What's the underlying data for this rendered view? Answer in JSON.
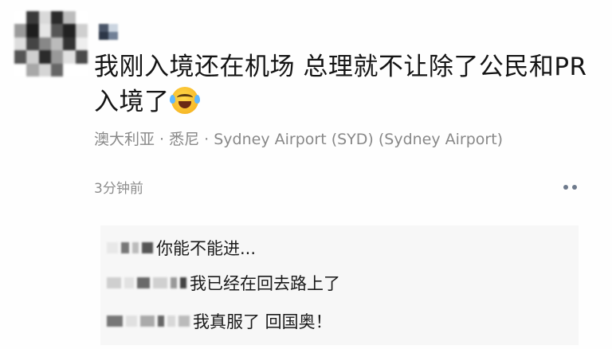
{
  "post": {
    "text": "我刚入境还在机场 总理就不让除了公民和PR入境了",
    "emoji": "tears-of-joy-emoji",
    "location": "澳大利亚 · 悉尼 · Sydney Airport (SYD) (Sydney Airport)",
    "time": "3分钟前"
  },
  "comments": [
    {
      "text": "你能不能进..."
    },
    {
      "text": "我已经在回去路上了"
    },
    {
      "text": "我真服了  回国奥！"
    }
  ],
  "colors": {
    "text": "#141414",
    "meta": "#888888",
    "comment_bg": "#f7f7f7",
    "more_dots": "#6e7a8c"
  }
}
